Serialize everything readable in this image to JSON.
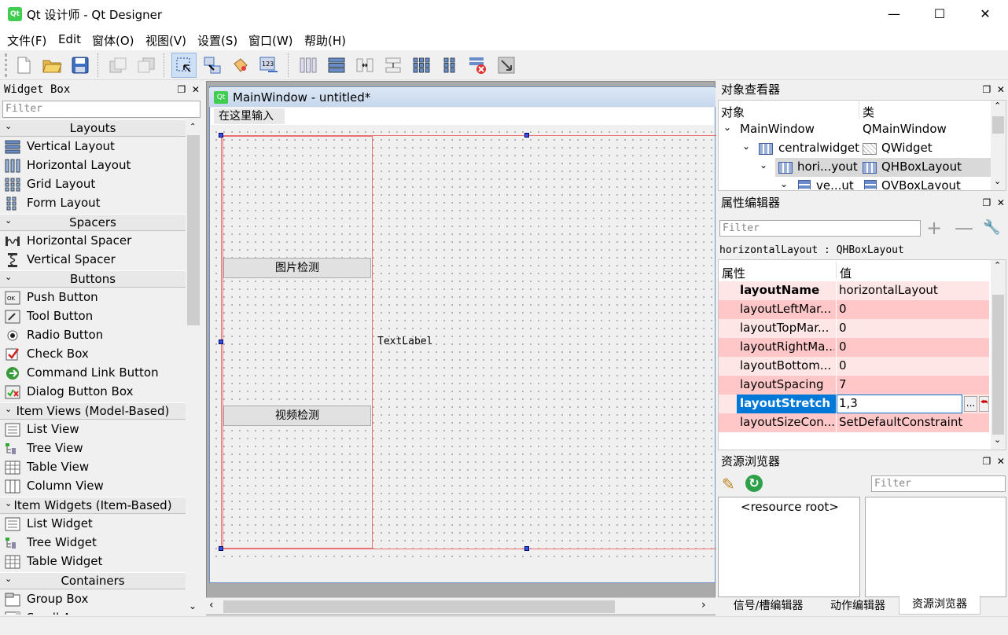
{
  "window": {
    "title": "Qt 设计师 - Qt Designer",
    "app_icon": "Qt"
  },
  "menu": [
    "文件(F)",
    "Edit",
    "窗体(O)",
    "视图(V)",
    "设置(S)",
    "窗口(W)",
    "帮助(H)"
  ],
  "widget_box": {
    "title": "Widget Box",
    "filter_placeholder": "Filter",
    "categories": [
      {
        "label": "Layouts",
        "items": [
          "Vertical Layout",
          "Horizontal Layout",
          "Grid Layout",
          "Form Layout"
        ]
      },
      {
        "label": "Spacers",
        "items": [
          "Horizontal Spacer",
          "Vertical Spacer"
        ]
      },
      {
        "label": "Buttons",
        "items": [
          "Push Button",
          "Tool Button",
          "Radio Button",
          "Check Box",
          "Command Link Button",
          "Dialog Button Box"
        ]
      },
      {
        "label": "Item Views (Model-Based)",
        "items": [
          "List View",
          "Tree View",
          "Table View",
          "Column View"
        ]
      },
      {
        "label": "Item Widgets (Item-Based)",
        "items": [
          "List Widget",
          "Tree Widget",
          "Table Widget"
        ]
      },
      {
        "label": "Containers",
        "items": [
          "Group Box",
          "Scroll Area"
        ]
      }
    ]
  },
  "form": {
    "title": "MainWindow - untitled*",
    "icon": "Qt",
    "menu_placeholder": "在这里输入",
    "button1": "图片检测",
    "button2": "视频检测",
    "label": "TextLabel"
  },
  "object_inspector": {
    "title": "对象查看器",
    "col_object": "对象",
    "col_class": "类",
    "rows": [
      {
        "name": "MainWindow",
        "class": "QMainWindow"
      },
      {
        "name": "centralwidget",
        "class": "QWidget"
      },
      {
        "name": "hori...yout",
        "class": "QHBoxLayout"
      },
      {
        "name": "ve...ut",
        "class": "QVBoxLayout"
      }
    ]
  },
  "property_editor": {
    "title": "属性编辑器",
    "filter_placeholder": "Filter",
    "context": "horizontalLayout : QHBoxLayout",
    "col_property": "属性",
    "col_value": "值",
    "rows": [
      {
        "name": "layoutName",
        "value": "horizontalLayout"
      },
      {
        "name": "layoutLeftMar...",
        "value": "0"
      },
      {
        "name": "layoutTopMar...",
        "value": "0"
      },
      {
        "name": "layoutRightMa...",
        "value": "0"
      },
      {
        "name": "layoutBottom...",
        "value": "0"
      },
      {
        "name": "layoutSpacing",
        "value": "7"
      },
      {
        "name": "layoutStretch",
        "value": "1,3"
      },
      {
        "name": "layoutSizeCon...",
        "value": "SetDefaultConstraint"
      }
    ],
    "edit_button": "..."
  },
  "resource_browser": {
    "title": "资源浏览器",
    "filter_placeholder": "Filter",
    "root": "<resource root>"
  },
  "tabs": [
    "信号/槽编辑器",
    "动作编辑器",
    "资源浏览器"
  ],
  "colors": {
    "accent": "#0078d7",
    "prop_row_light": "#ffe6e6",
    "prop_row_dark": "#ffc7c7",
    "selection": "#d9d9d9",
    "qt_green": "#41cd52"
  }
}
